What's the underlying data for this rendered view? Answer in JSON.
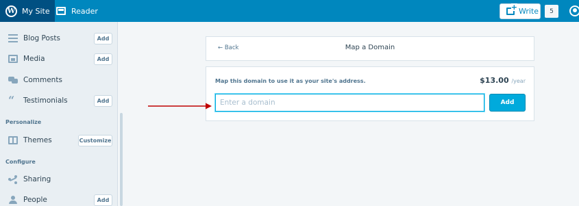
{
  "masterbar": {
    "my_site": "My Site",
    "reader": "Reader",
    "write": "Write",
    "count": "5"
  },
  "sidebar": {
    "items": [
      {
        "label": "Blog Posts",
        "icon": "posts-icon",
        "button": "Add"
      },
      {
        "label": "Media",
        "icon": "media-icon",
        "button": "Add"
      },
      {
        "label": "Comments",
        "icon": "comments-icon",
        "button": ""
      },
      {
        "label": "Testimonials",
        "icon": "quote-icon",
        "button": "Add"
      },
      {
        "label": "Themes",
        "icon": "themes-icon",
        "button": "Customize"
      },
      {
        "label": "Sharing",
        "icon": "share-icon",
        "button": ""
      },
      {
        "label": "People",
        "icon": "people-icon",
        "button": "Add"
      }
    ],
    "sections": {
      "personalize": "Personalize",
      "configure": "Configure"
    }
  },
  "header": {
    "back": "← Back",
    "title": "Map a Domain"
  },
  "domain": {
    "label": "Map this domain to use it as your site's address.",
    "price": "$13.00",
    "per": "/year",
    "placeholder": "Enter a domain",
    "add": "Add"
  },
  "colors": {
    "masterbar": "#0087be",
    "accent": "#00aadc",
    "annotation_arrow": "#c00000"
  }
}
